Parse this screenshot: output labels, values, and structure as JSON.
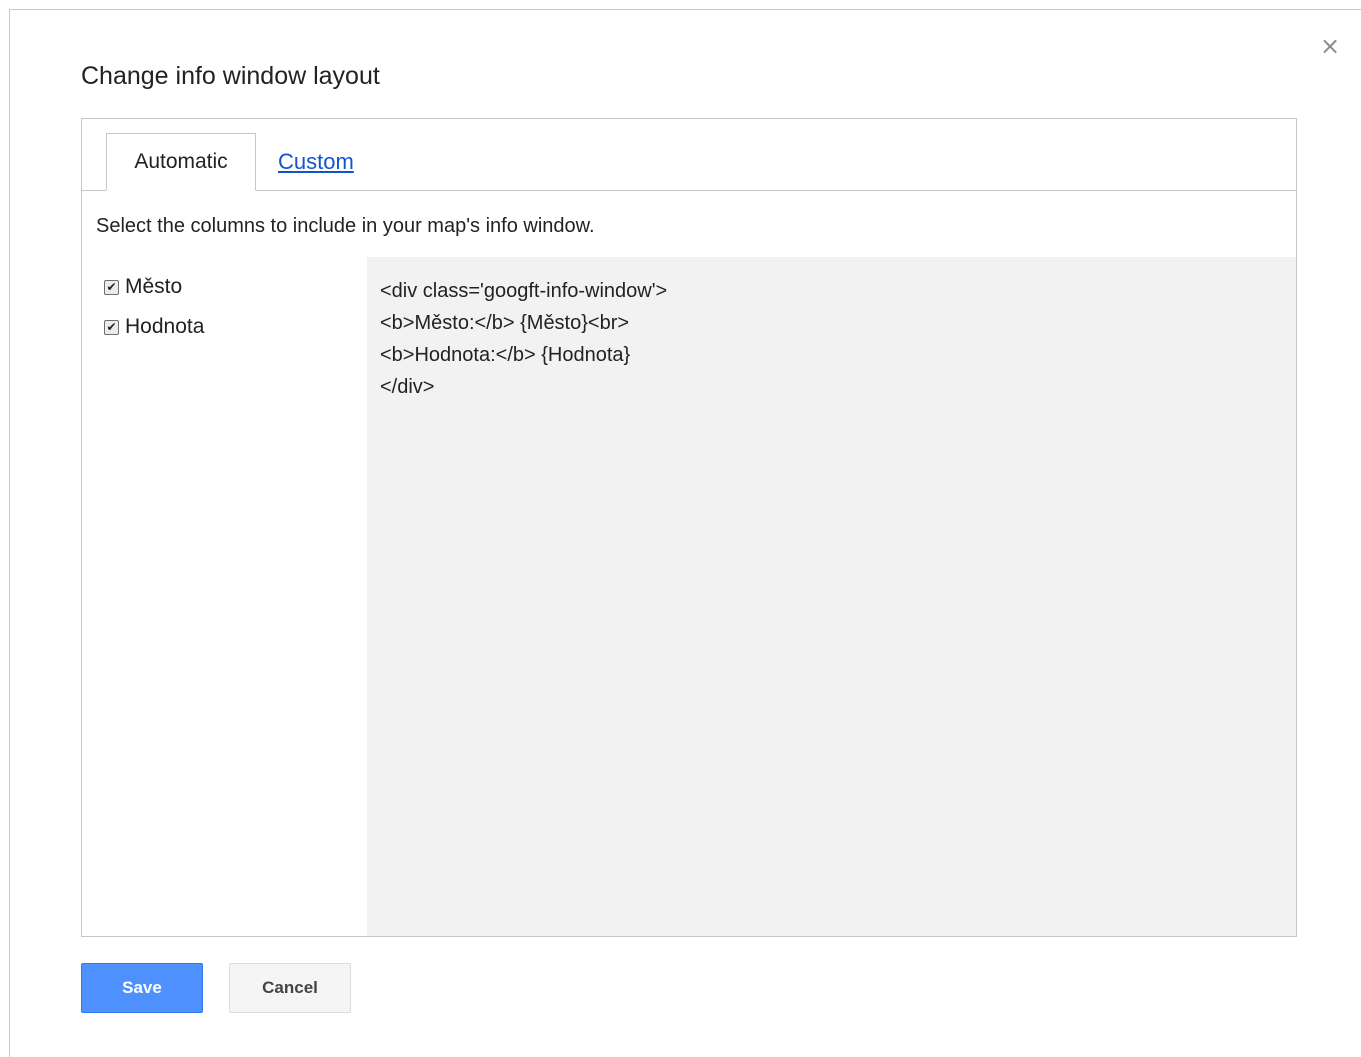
{
  "dialog": {
    "title": "Change info window layout",
    "close_icon": "×"
  },
  "tabs": [
    {
      "label": "Automatic",
      "active": true
    },
    {
      "label": "Custom",
      "active": false
    }
  ],
  "instructions": "Select the columns to include in your map's info window.",
  "columns": [
    {
      "label": "Město",
      "checked": true,
      "check_glyph": "✔"
    },
    {
      "label": "Hodnota",
      "checked": true,
      "check_glyph": "✔"
    }
  ],
  "code_preview": {
    "lines": [
      "<div class='googft-info-window'>",
      "<b>Město:</b> {Město}<br>",
      "<b>Hodnota:</b> {Hodnota}",
      "</div>"
    ]
  },
  "buttons": {
    "save_label": "Save",
    "cancel_label": "Cancel"
  },
  "colors": {
    "primary_button": "#4d90fe",
    "link": "#1155cc",
    "preview_background": "#f2f2f2"
  }
}
